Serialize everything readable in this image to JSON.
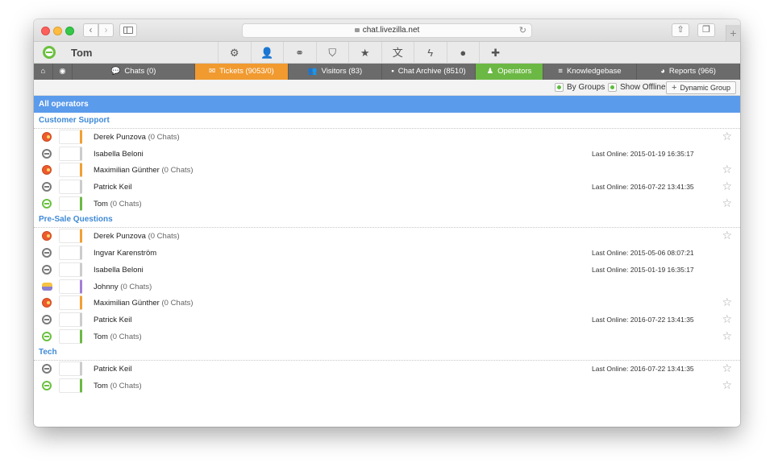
{
  "browser": {
    "url": "chat.livezilla.net"
  },
  "header": {
    "username": "Tom",
    "toolbar_icons": [
      "gears-icon",
      "user-icon",
      "link-icon",
      "shield-icon",
      "star-icon",
      "translate-icon",
      "bolt-icon",
      "info-icon",
      "plus-icon"
    ]
  },
  "tabs": [
    {
      "id": "home",
      "label": "",
      "icon": "home-icon",
      "glyph": "⌂"
    },
    {
      "id": "globe",
      "label": "",
      "icon": "globe-icon",
      "glyph": "◉"
    },
    {
      "id": "chats",
      "label": "Chats (0)",
      "icon": "chat-icon",
      "glyph": "💬"
    },
    {
      "id": "tickets",
      "label": "Tickets (9053/0)",
      "icon": "mail-icon",
      "glyph": "✉"
    },
    {
      "id": "visitors",
      "label": "Visitors (83)",
      "icon": "visitors-icon",
      "glyph": "👥"
    },
    {
      "id": "archive",
      "label": "Chat Archive (8510)",
      "icon": "archive-icon",
      "glyph": "▪"
    },
    {
      "id": "operators",
      "label": "Operators",
      "icon": "operator-icon",
      "glyph": "♟"
    },
    {
      "id": "kb",
      "label": "Knowledgebase",
      "icon": "database-icon",
      "glyph": "≡"
    },
    {
      "id": "reports",
      "label": "Reports (966)",
      "icon": "pie-icon",
      "glyph": "◕"
    }
  ],
  "filter": {
    "by_groups": "By Groups",
    "show_offline": "Show Offline",
    "dynamic_group": "Dynamic Group"
  },
  "banner": "All operators",
  "groups": [
    {
      "title": "Customer Support",
      "operators": [
        {
          "name": "Derek Punzova",
          "chats": "(0 Chats)",
          "status": "busy",
          "color": "#f0a033",
          "last": "",
          "star": true
        },
        {
          "name": "Isabella Beloni",
          "chats": "",
          "status": "offline",
          "color": "#cccccc",
          "last": "Last Online: 2015-01-19 16:35:17",
          "star": false
        },
        {
          "name": "Maximilian Günther",
          "chats": "(0 Chats)",
          "status": "busy",
          "color": "#f0a033",
          "last": "",
          "star": true
        },
        {
          "name": "Patrick Keil",
          "chats": "",
          "status": "offline",
          "color": "#cccccc",
          "last": "Last Online: 2016-07-22 13:41:35",
          "star": true
        },
        {
          "name": "Tom",
          "chats": "(0 Chats)",
          "status": "online",
          "color": "#6cb844",
          "last": "",
          "star": true
        }
      ]
    },
    {
      "title": "Pre-Sale Questions",
      "operators": [
        {
          "name": "Derek Punzova",
          "chats": "(0 Chats)",
          "status": "busy",
          "color": "#f0a033",
          "last": "",
          "star": true
        },
        {
          "name": "Ingvar Karenström",
          "chats": "",
          "status": "offline",
          "color": "#cccccc",
          "last": "Last Online: 2015-05-06 08:07:21",
          "star": false
        },
        {
          "name": "Isabella Beloni",
          "chats": "",
          "status": "offline",
          "color": "#cccccc",
          "last": "Last Online: 2015-01-19 16:35:17",
          "star": false
        },
        {
          "name": "Johnny",
          "chats": "(0 Chats)",
          "status": "bot",
          "color": "#a27fd6",
          "last": "",
          "star": false
        },
        {
          "name": "Maximilian Günther",
          "chats": "(0 Chats)",
          "status": "busy",
          "color": "#f0a033",
          "last": "",
          "star": true
        },
        {
          "name": "Patrick Keil",
          "chats": "",
          "status": "offline",
          "color": "#cccccc",
          "last": "Last Online: 2016-07-22 13:41:35",
          "star": true
        },
        {
          "name": "Tom",
          "chats": "(0 Chats)",
          "status": "online",
          "color": "#6cb844",
          "last": "",
          "star": true
        }
      ]
    },
    {
      "title": "Tech",
      "operators": [
        {
          "name": "Patrick Keil",
          "chats": "",
          "status": "offline",
          "color": "#cccccc",
          "last": "Last Online: 2016-07-22 13:41:35",
          "star": true
        },
        {
          "name": "Tom",
          "chats": "(0 Chats)",
          "status": "online",
          "color": "#6cb844",
          "last": "",
          "star": true
        }
      ]
    }
  ]
}
